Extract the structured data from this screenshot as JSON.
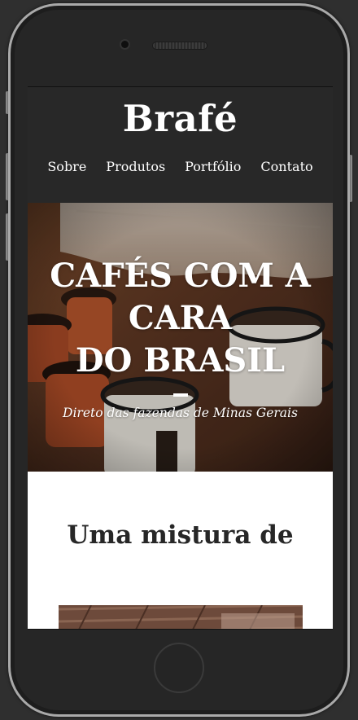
{
  "site": {
    "brand": "Brafé",
    "nav": [
      {
        "label": "Sobre"
      },
      {
        "label": "Produtos"
      },
      {
        "label": "Portfólio"
      },
      {
        "label": "Contato"
      }
    ]
  },
  "hero": {
    "title_line1": "CAFÉS COM A CARA",
    "title_line2": "DO BRASIL",
    "subtitle": "Direto das fazendas de Minas Gerais"
  },
  "about": {
    "title": "Uma mistura de"
  },
  "colors": {
    "header_bg": "#282828",
    "text_dark": "#272727",
    "phone_frame": "#262626",
    "phone_rim": "#a9a9a9"
  },
  "icons": {
    "camera": "front-camera-icon",
    "speaker": "earpiece-speaker-icon",
    "home": "home-button-icon"
  }
}
